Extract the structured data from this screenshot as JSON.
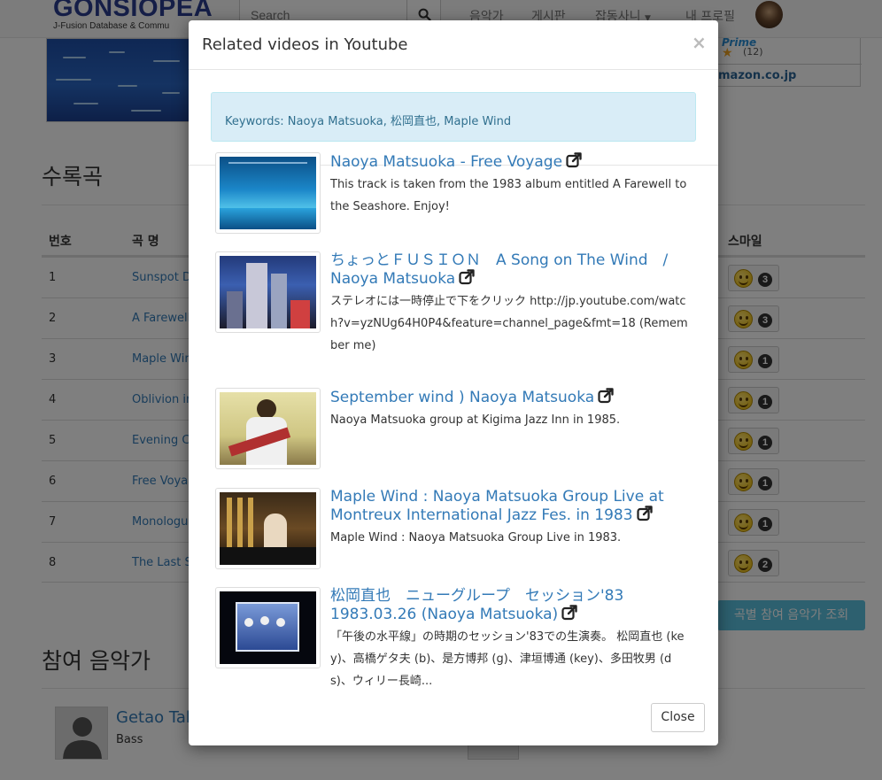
{
  "navbar": {
    "brand_title": "GONSIOPEA",
    "brand_subtitle": "J-Fusion Database & Commu",
    "search_placeholder": "Search",
    "items": [
      "음악가",
      "게시판",
      "잡동사니",
      "내 프로필"
    ]
  },
  "amazon": {
    "prime": "Prime",
    "rating_count": "(12)",
    "link": "mazon.co.jp"
  },
  "tracks_section": {
    "title": "수록곡",
    "headers": {
      "number": "번호",
      "title": "곡 명",
      "smile": "스마일"
    },
    "rows": [
      {
        "number": "1",
        "title": "Sunspot D",
        "smiles": "3"
      },
      {
        "number": "2",
        "title": "A Farewell",
        "smiles": "3"
      },
      {
        "number": "3",
        "title": "Maple Wir",
        "smiles": "1"
      },
      {
        "number": "4",
        "title": "Oblivion ir",
        "smiles": "1"
      },
      {
        "number": "5",
        "title": "Evening C",
        "smiles": "1"
      },
      {
        "number": "6",
        "title": "Free Voya",
        "smiles": "1"
      },
      {
        "number": "7",
        "title": "Monologu",
        "smiles": "1"
      },
      {
        "number": "8",
        "title": "The Last S",
        "smiles": "2"
      }
    ],
    "button_label": "곡별 참여 음악가 조회"
  },
  "musicians_section": {
    "title": "참여 음악가",
    "first": {
      "name": "Getao Tak",
      "role": "Bass"
    }
  },
  "modal": {
    "title": "Related videos in Youtube",
    "keywords": "Keywords: Naoya Matsuoka, 松岡直也, Maple Wind",
    "close_label": "Close",
    "videos": [
      {
        "title": "Naoya Matsuoka - Free Voyage",
        "description": "This track is taken from the 1983 album entitled A Farewell to the Seashore. Enjoy!"
      },
      {
        "title": "ちょっとＦＵＳＩＯＮ　A Song on The Wind　/ Naoya Matsuoka",
        "description": "ステレオには一時停止で下をクリック http://jp.youtube.com/watch?v=yzNUg64H0P4&feature=channel_page&fmt=18 (Remember me)"
      },
      {
        "title": "September wind ) Naoya Matsuoka",
        "description": "Naoya Matsuoka group at Kigima Jazz Inn in 1985."
      },
      {
        "title": "Maple Wind : Naoya Matsuoka Group Live at Montreux International Jazz Fes. in 1983",
        "description": "Maple Wind : Naoya Matsuoka Group Live in 1983."
      },
      {
        "title": "松岡直也　ニューグループ　セッション'83 1983.03.26 (Naoya Matsuoka)",
        "description": "「午後の水平線」の時期のセッション'83での生演奏。 松岡直也 (key)、高橋ゲタ夫 (b)、是方博邦 (g)、津垣博通 (key)、多田牧男 (ds)、ウィリー長崎..."
      }
    ]
  },
  "colors": {
    "link": "#337ab7",
    "alert_bg": "#d9edf7",
    "alert_text": "#31708f",
    "info_button": "#5bc0de",
    "brand": "#2a3d8f"
  }
}
